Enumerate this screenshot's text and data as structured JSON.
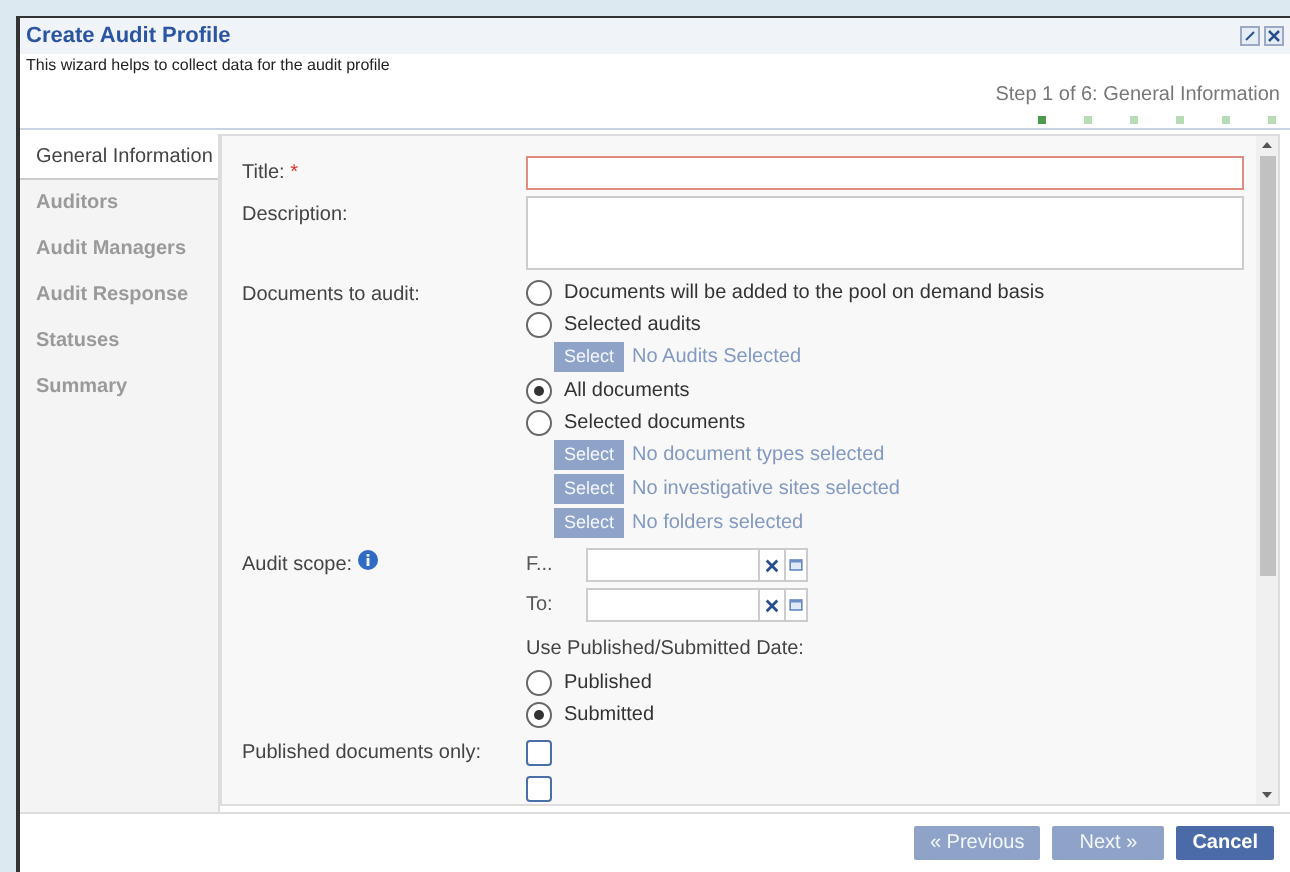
{
  "window": {
    "title": "Create Audit Profile"
  },
  "intro": "This wizard helps to collect data for the audit profile",
  "step_label": "Step 1 of 6: General Information",
  "steps": [
    {
      "selected": true
    },
    {
      "selected": false
    },
    {
      "selected": false
    },
    {
      "selected": false
    },
    {
      "selected": false
    },
    {
      "selected": false
    }
  ],
  "nav": [
    {
      "label": "General Information",
      "selected": true
    },
    {
      "label": "Auditors",
      "selected": false
    },
    {
      "label": "Audit Managers",
      "selected": false
    },
    {
      "label": "Audit Response",
      "selected": false
    },
    {
      "label": "Statuses",
      "selected": false
    },
    {
      "label": "Summary",
      "selected": false
    }
  ],
  "form": {
    "title_label": "Title:",
    "required_mark": "*",
    "description_label": "Description:",
    "documents_label": "Documents to audit:",
    "documents_options": [
      {
        "kind": "radio",
        "label": "Documents will be added to the pool on demand basis",
        "selected": false
      },
      {
        "kind": "radio",
        "label": "Selected audits",
        "selected": false
      },
      {
        "kind": "select",
        "button": "Select",
        "text": "No Audits Selected",
        "disabled": true
      },
      {
        "kind": "radio",
        "label": "All documents",
        "selected": true
      },
      {
        "kind": "radio",
        "label": "Selected documents",
        "selected": false
      },
      {
        "kind": "select",
        "button": "Select",
        "text": "No document types selected",
        "disabled": true
      },
      {
        "kind": "select",
        "button": "Select",
        "text": "No investigative sites selected",
        "disabled": true
      },
      {
        "kind": "select",
        "button": "Select",
        "text": "No folders selected",
        "disabled": true
      }
    ],
    "scope_label": "Audit scope:",
    "from_label": "F...",
    "to_label": "To:",
    "date_basis_label": "Use Published/Submitted Date:",
    "date_basis_options": [
      {
        "label": "Published",
        "selected": false
      },
      {
        "label": "Submitted",
        "selected": true
      }
    ],
    "published_only_label": "Published documents only:",
    "published_only_checked": false,
    "next_checked": false
  },
  "buttons": [
    {
      "label": "« Previous",
      "disabled": true
    },
    {
      "label": "Next »",
      "disabled": true
    },
    {
      "label": "Cancel",
      "disabled": false
    }
  ]
}
